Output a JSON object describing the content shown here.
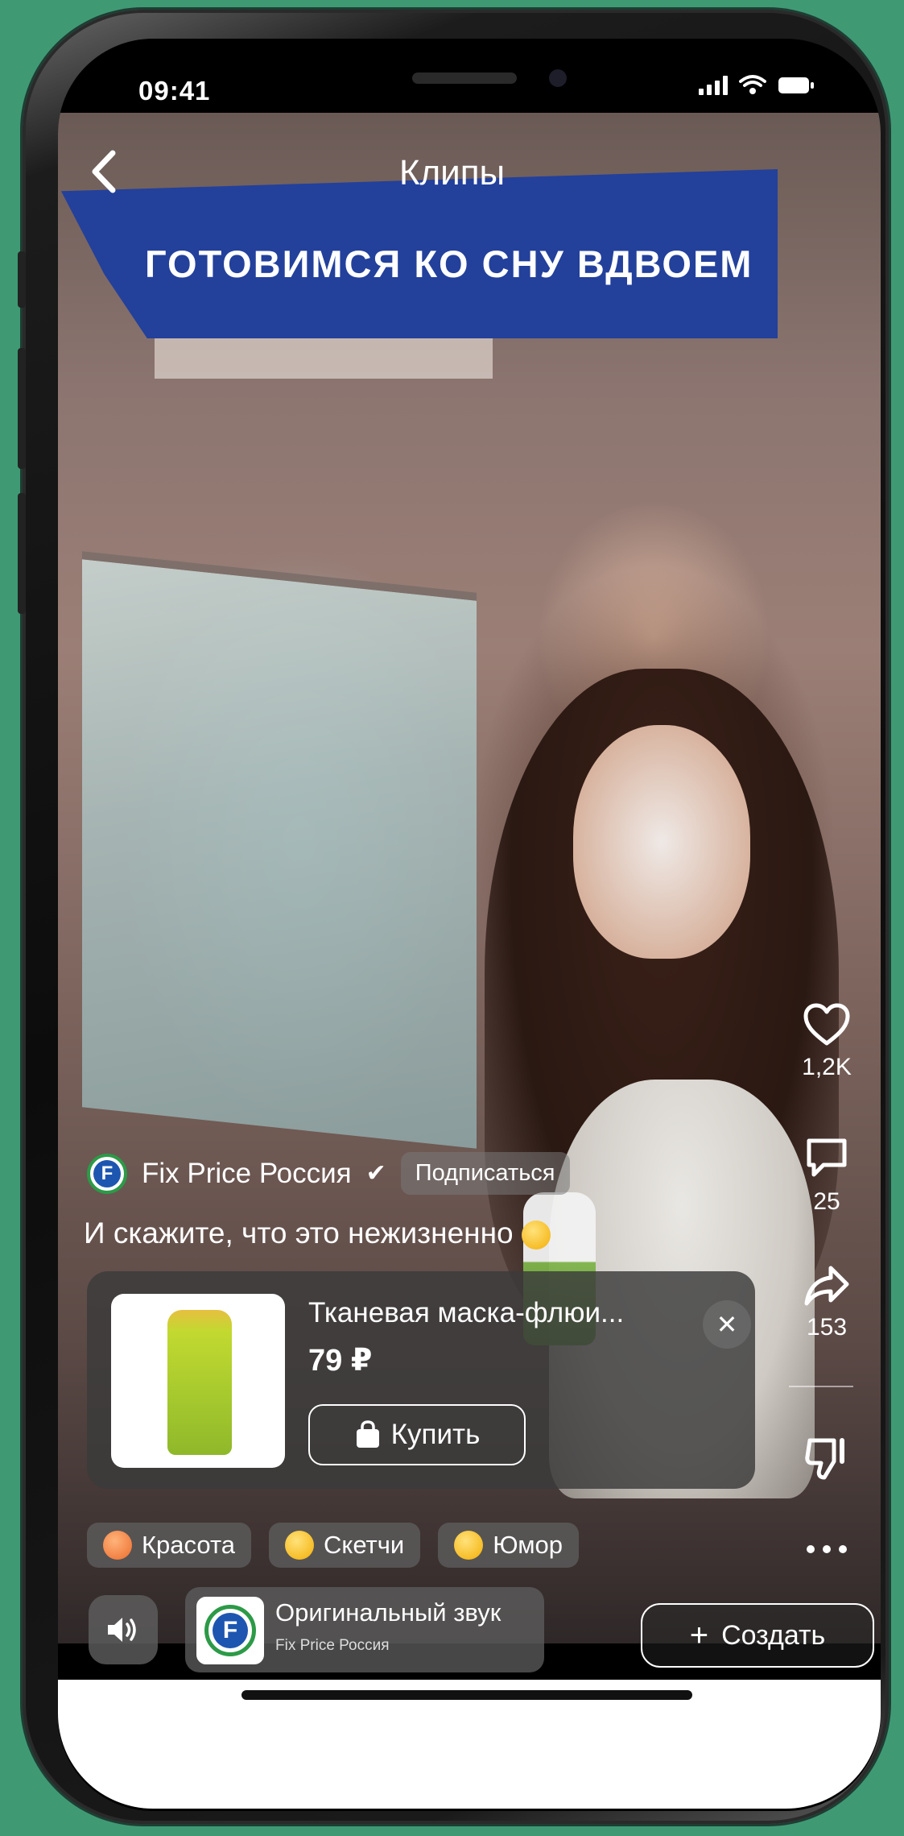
{
  "status_bar": {
    "time": "09:41"
  },
  "header": {
    "title": "Клипы"
  },
  "banner": {
    "text": "ГОТОВИМСЯ КО СНУ ВДВОЕМ"
  },
  "actions": {
    "likes": "1,2K",
    "comments": "25",
    "shares": "153"
  },
  "author": {
    "name": "Fix Price Россия",
    "verified_mark": "✔",
    "subscribe_label": "Подписаться",
    "logo_letter": "F"
  },
  "caption": {
    "text": "И скажите, что это нежизненно"
  },
  "product": {
    "name": "Тканевая маска-флюи...",
    "price": "79 ₽",
    "buy_label": "Купить",
    "close_symbol": "✕"
  },
  "tags": [
    {
      "label": "Красота",
      "icon": "heart-eyes-emoji"
    },
    {
      "label": "Скетчи",
      "icon": "grin-emoji"
    },
    {
      "label": "Юмор",
      "icon": "laugh-emoji"
    }
  ],
  "sound": {
    "title": "Оригинальный звук",
    "author": "Fix Price Россия"
  },
  "create": {
    "label": "Создать",
    "plus": "+"
  },
  "colors": {
    "background": "#3f9a74",
    "banner": "#23409b",
    "fixprice_blue": "#1d56b0",
    "fixprice_green": "#2c9a47"
  }
}
